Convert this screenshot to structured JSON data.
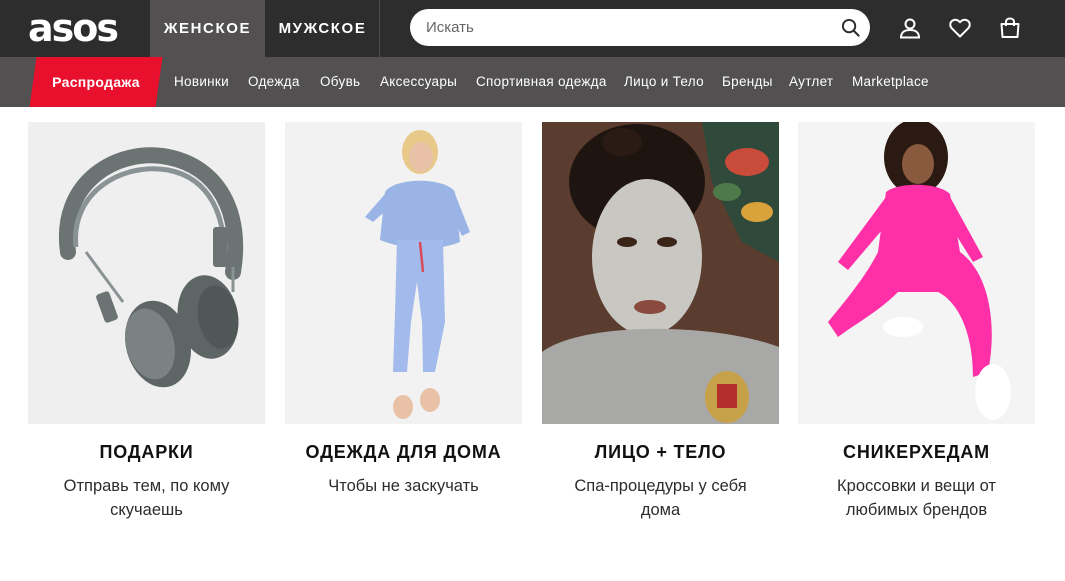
{
  "header": {
    "logo": "asos",
    "tabs": [
      {
        "label": "ЖЕНСКОЕ",
        "active": true
      },
      {
        "label": "МУЖСКОЕ",
        "active": false
      }
    ],
    "search": {
      "placeholder": "Искать",
      "value": ""
    },
    "icons": [
      "search-icon",
      "account-icon",
      "heart-icon",
      "bag-icon"
    ]
  },
  "nav": {
    "sale": "Распродажа",
    "items": [
      "Новинки",
      "Одежда",
      "Обувь",
      "Аксессуары",
      "Спортивная одежда",
      "Лицо и Тело",
      "Бренды",
      "Аутлет",
      "Marketplace"
    ]
  },
  "cards": [
    {
      "title": "ПОДАРКИ",
      "subtitle": "Отправь тем, по кому скучаешь",
      "image": "headphones"
    },
    {
      "title": "ОДЕЖДА ДЛЯ ДОМА",
      "subtitle": "Чтобы не заскучать",
      "image": "blue-loungewear"
    },
    {
      "title": "ЛИЦО + ТЕЛО",
      "subtitle": "Спа-процедуры у себя дома",
      "image": "face-mask"
    },
    {
      "title": "СНИКЕРХЕДАМ",
      "subtitle": "Кроссовки и вещи от любимых брендов",
      "image": "pink-tracksuit"
    }
  ],
  "colors": {
    "topbar": "#2d2d2d",
    "navbar": "#525050",
    "sale": "#e8102c",
    "text": "#2d2d2d"
  }
}
